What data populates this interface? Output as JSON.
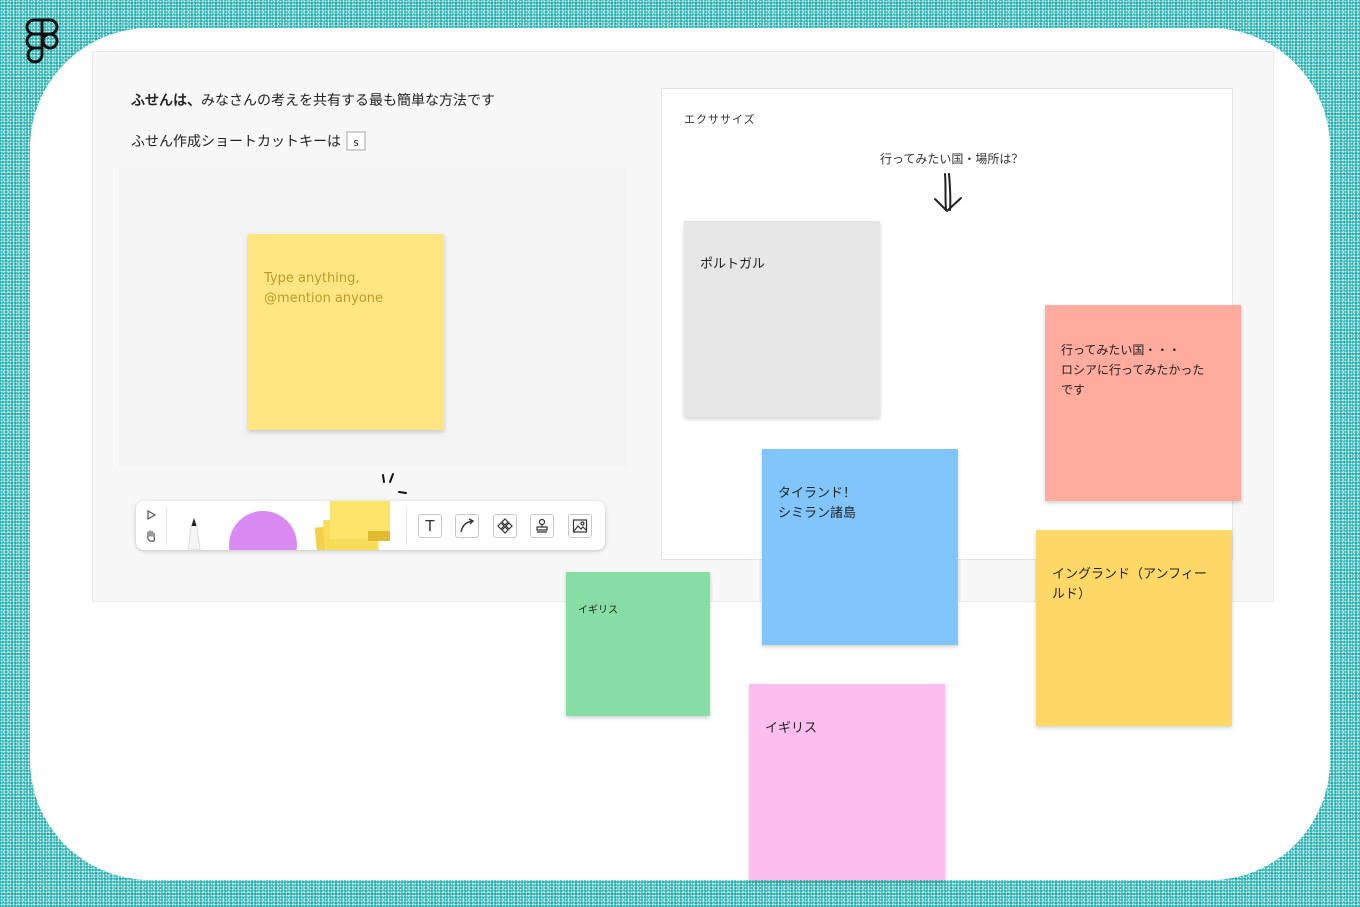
{
  "intro": {
    "heading_bold": "ふせんは、",
    "heading_rest": "みなさんの考えを共有する最も簡単な方法です",
    "shortcut_text": "ふせん作成ショートカットキーは",
    "shortcut_key": "s"
  },
  "demo_sticky": {
    "placeholder": "Type anything, @mention anyone",
    "color": "#ffe680"
  },
  "toolbar": {
    "tools": [
      "move-tool",
      "hand-tool",
      "pen",
      "shape",
      "sticky-note",
      "text",
      "connector",
      "component",
      "stamp",
      "image"
    ],
    "text_label": "T"
  },
  "exercise": {
    "title": "エクササイズ",
    "question": "行ってみたい国・場所は？"
  },
  "stickies": [
    {
      "text": "ポルトガル",
      "color": "#e6e6e6"
    },
    {
      "text": "行ってみたい国・・・\nロシアに行ってみたかった\nです",
      "color": "#ffab9e"
    },
    {
      "text": "タイランド！\nシミラン諸島",
      "color": "#80c6fc"
    },
    {
      "text": "イギリス",
      "color": "#86dea5"
    },
    {
      "text": "イングランド（アンフィー\nルド）",
      "color": "#fdd866"
    },
    {
      "text": "イギリス",
      "color": "#fbbeef"
    }
  ],
  "colors": {
    "background_teal": "#1fb3b0",
    "panel": "#f7f7f7"
  }
}
